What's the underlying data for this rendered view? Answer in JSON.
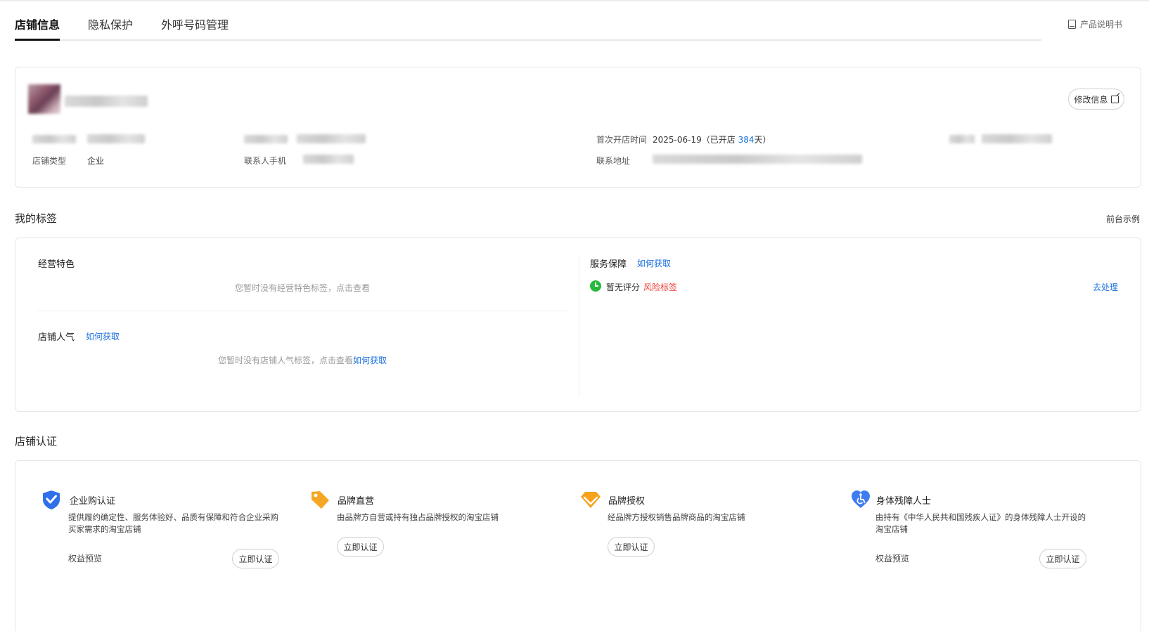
{
  "tabs": [
    "店铺信息",
    "隐私保护",
    "外呼号码管理"
  ],
  "manual_label": "产品说明书",
  "store": {
    "edit_label": "修改信息",
    "labels": {
      "open_time": "首次开店时间",
      "store_type": "店铺类型",
      "contact_phone": "联系人手机",
      "address": "联系地址"
    },
    "open_date": "2025-06-19",
    "open_prefix": "（已开店 ",
    "open_days": "384",
    "open_suffix": "天）",
    "store_type_value": "企业"
  },
  "tags": {
    "title": "我的标签",
    "front_example": "前台示例",
    "feature_title": "经营特色",
    "feature_empty": "您暂时没有经营特色标签，点击查看",
    "popularity_title": "店铺人气",
    "how_to_get": "如何获取",
    "popularity_empty": "您暂时没有店铺人气标签，点击查看",
    "service_title": "服务保障",
    "no_score": "暂无评分",
    "risk_tag": "风险标签",
    "handle": "去处理"
  },
  "cert": {
    "title": "店铺认证",
    "items": [
      {
        "title": "企业购认证",
        "desc": "提供履约确定性、服务体验好、品质有保障和符合企业采购买家需求的淘宝店铺",
        "benefit": "权益预览",
        "action": "立即认证",
        "icon": "shield-check-icon"
      },
      {
        "title": "品牌直营",
        "desc": "由品牌方自营或持有独占品牌授权的淘宝店铺",
        "action": "立即认证",
        "icon": "tag-icon"
      },
      {
        "title": "品牌授权",
        "desc": "经品牌方授权销售品牌商品的淘宝店铺",
        "action": "立即认证",
        "icon": "diamond-icon"
      },
      {
        "title": "身体残障人士",
        "desc": "由持有《中华人民共和国残疾人证》的身体残障人士开设的淘宝店铺",
        "benefit": "权益预览",
        "action": "立即认证",
        "icon": "accessibility-heart-icon"
      }
    ]
  },
  "colors": {
    "link": "#1a6fe0",
    "risk": "#f0403a",
    "shield": "#2f6fe8",
    "tag": "#f5a623",
    "diamond": "#f7a21b",
    "heart": "#3f7cf0"
  }
}
